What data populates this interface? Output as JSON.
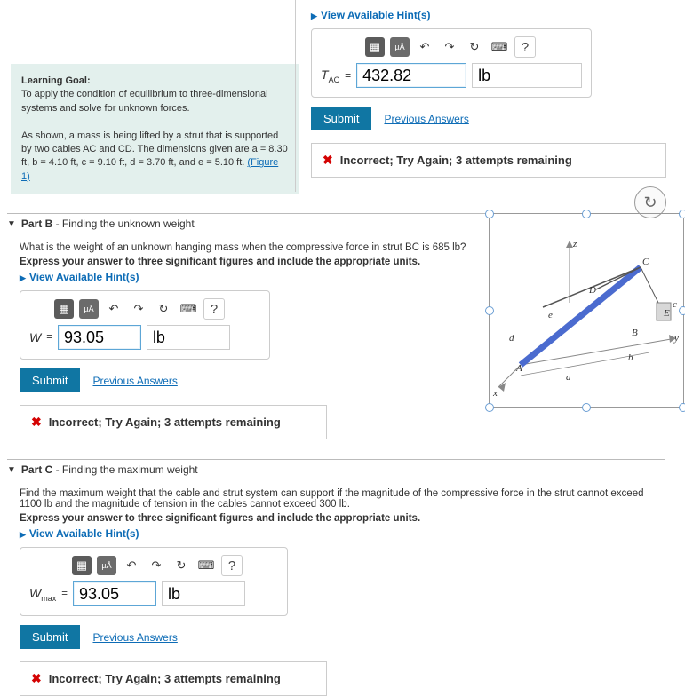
{
  "learning_goal": {
    "title": "Learning Goal:",
    "desc": "To apply the condition of equilibrium to three-dimensional systems and solve for unknown forces.",
    "problem_intro": "As shown, a mass is being lifted by a strut that is supported by two cables AC and CD. The dimensions given are a = 8.30 ft, b = 4.10 ft, c = 9.10 ft, d = 3.70 ft, and e = 5.10 ft.",
    "figure_link": "(Figure 1)"
  },
  "top_answer": {
    "hint": "View Available Hint(s)",
    "var": "T",
    "sub": "AC",
    "eq": "=",
    "value": "432.82",
    "unit": "lb",
    "submit": "Submit",
    "prev": "Previous Answers",
    "feedback": "Incorrect; Try Again; 3 attempts remaining"
  },
  "toolbars": {
    "ua": "µÅ",
    "undo": "↶",
    "redo": "↷",
    "reset": "↻",
    "kbd": "⌨",
    "help": "?"
  },
  "part_b": {
    "header_bold": "Part B",
    "header_rest": " - Finding the unknown weight",
    "q": "What is the weight of an unknown hanging mass when the compressive force in strut BC is   685 lb?",
    "instr": "Express your answer to three significant figures and include the appropriate units.",
    "hint": "View Available Hint(s)",
    "var": "W",
    "eq": "=",
    "value": "93.05",
    "unit": "lb",
    "submit": "Submit",
    "prev": "Previous Answers",
    "feedback": "Incorrect; Try Again; 3 attempts remaining"
  },
  "part_c": {
    "header_bold": "Part C",
    "header_rest": " - Finding the maximum weight",
    "q": "Find the maximum weight that the cable and strut system can support if the magnitude of the compressive force in the strut cannot exceed 1100 lb and the magnitude of tension in the cables cannot exceed 300 lb.",
    "instr": "Express your answer to three significant figures and include the appropriate units.",
    "hint": "View Available Hint(s)",
    "var": "W",
    "sub": "max",
    "eq": "=",
    "value": "93.05",
    "unit": "lb",
    "submit": "Submit",
    "prev": "Previous Answers",
    "feedback": "Incorrect; Try Again; 3 attempts remaining"
  },
  "figure": {
    "labels": {
      "x": "x",
      "y": "y",
      "z": "z",
      "A": "A",
      "B": "B",
      "C": "C",
      "D": "D",
      "E": "E",
      "a": "a",
      "b": "b",
      "c": "c",
      "d": "d",
      "e": "e"
    }
  }
}
